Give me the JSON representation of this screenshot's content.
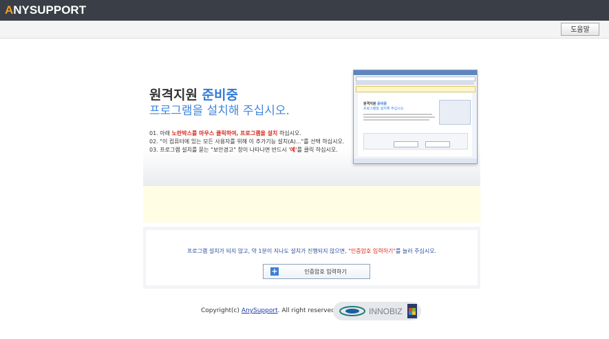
{
  "header": {
    "logo_accent": "A",
    "logo_rest": "NYSUPPORT",
    "help_label": "도움말"
  },
  "hero": {
    "title_prefix": "원격지원",
    "title_highlight": "준비중",
    "subtitle": "프로그램을 설치해 주십시오.",
    "step1_a": "01. 아래",
    "step1_b": "노란박스를 마우스 클릭하여,",
    "step1_c": "프로그램을 설치",
    "step1_d": "하십시오.",
    "step2": "02. \"이 컴퓨터에 있는 모든 사용자를 위해 이 추가기능 설치(A)...\"를 선택 하십시오.",
    "step3_a": "03. 프로그램 설치를 묻는 \"보안경고\" 창이 나타나면 반드시",
    "step3_b": "'예'",
    "step3_c": "를 클릭 하십시오.",
    "mini_title_prefix": "원격지원",
    "mini_title_highlight": "준비중",
    "mini_subtitle": "프로그램을 설치해 주십시오."
  },
  "panel": {
    "notice_a": "프로그램 설치가 되지 않고, 약 1분이 지나도 설치가 진행되지 않으면,",
    "notice_b": "\"인증암호 입력하기\"",
    "notice_c": "를 눌러 주십시오.",
    "button_label": "인증암호 입력하기"
  },
  "footer": {
    "copyright_a": "Copyright(c)",
    "link": "AnySupport",
    "copyright_b": ". All right reserved.",
    "innobiz": "INNOBIZ"
  },
  "colors": {
    "topbar": "#3a3f47",
    "accent_orange": "#f0a020",
    "highlight_blue": "#2f7ad8",
    "alert_red": "#d8281c",
    "yellow_box": "#fffde3"
  }
}
